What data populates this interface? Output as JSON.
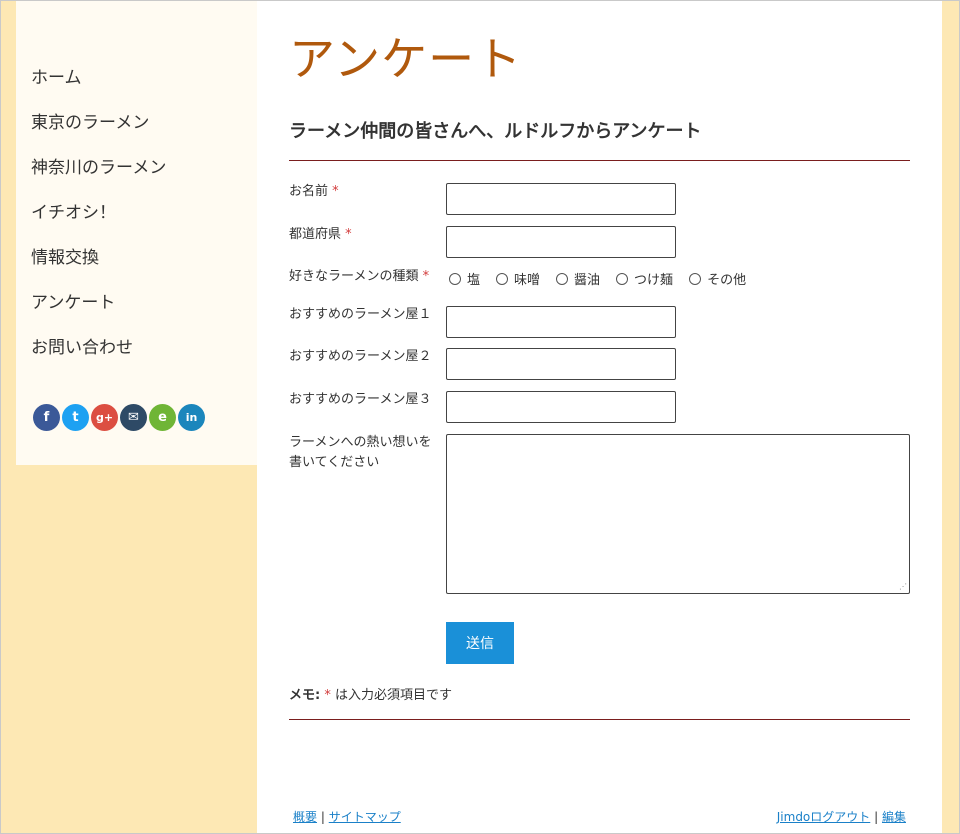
{
  "sidebar": {
    "nav": [
      "ホーム",
      "東京のラーメン",
      "神奈川のラーメン",
      "イチオシ！",
      "情報交換",
      "アンケート",
      "お問い合わせ"
    ],
    "social": [
      {
        "name": "facebook-icon",
        "glyph": "f",
        "color": "#3b5998"
      },
      {
        "name": "twitter-icon",
        "glyph": "t",
        "color": "#1da1f2"
      },
      {
        "name": "google-plus-icon",
        "glyph": "g+",
        "color": "#dc4e41"
      },
      {
        "name": "email-icon",
        "glyph": "✉",
        "color": "#2e4a66"
      },
      {
        "name": "evernote-icon",
        "glyph": "e",
        "color": "#6fb536"
      },
      {
        "name": "linkedin-icon",
        "glyph": "in",
        "color": "#1b86bc"
      }
    ]
  },
  "main": {
    "title": "アンケート",
    "form_heading": "ラーメン仲間の皆さんへ、ルドルフからアンケート",
    "labels": {
      "name": "お名前",
      "prefecture": "都道府県",
      "favorite_type": "好きなラーメンの種類",
      "rec1": "おすすめのラーメン屋１",
      "rec2": "おすすめのラーメン屋２",
      "rec3": "おすすめのラーメン屋３",
      "message": "ラーメンへの熱い想いを書いてください"
    },
    "required_mark": "*",
    "radio_options": [
      "塩",
      "味噌",
      "醤油",
      "つけ麺",
      "その他"
    ],
    "submit_label": "送信",
    "memo_label": "メモ:",
    "memo_text": "は入力必須項目です"
  },
  "footer": {
    "about": "概要",
    "sitemap": "サイトマップ",
    "logout": "Jimdoログアウト",
    "edit": "編集",
    "sep": "|"
  },
  "colors": {
    "page_bg": "#fde8b4",
    "title": "#b0590d",
    "rule": "#7a1e1e",
    "button": "#1a90d8",
    "required": "#d23a3a"
  }
}
